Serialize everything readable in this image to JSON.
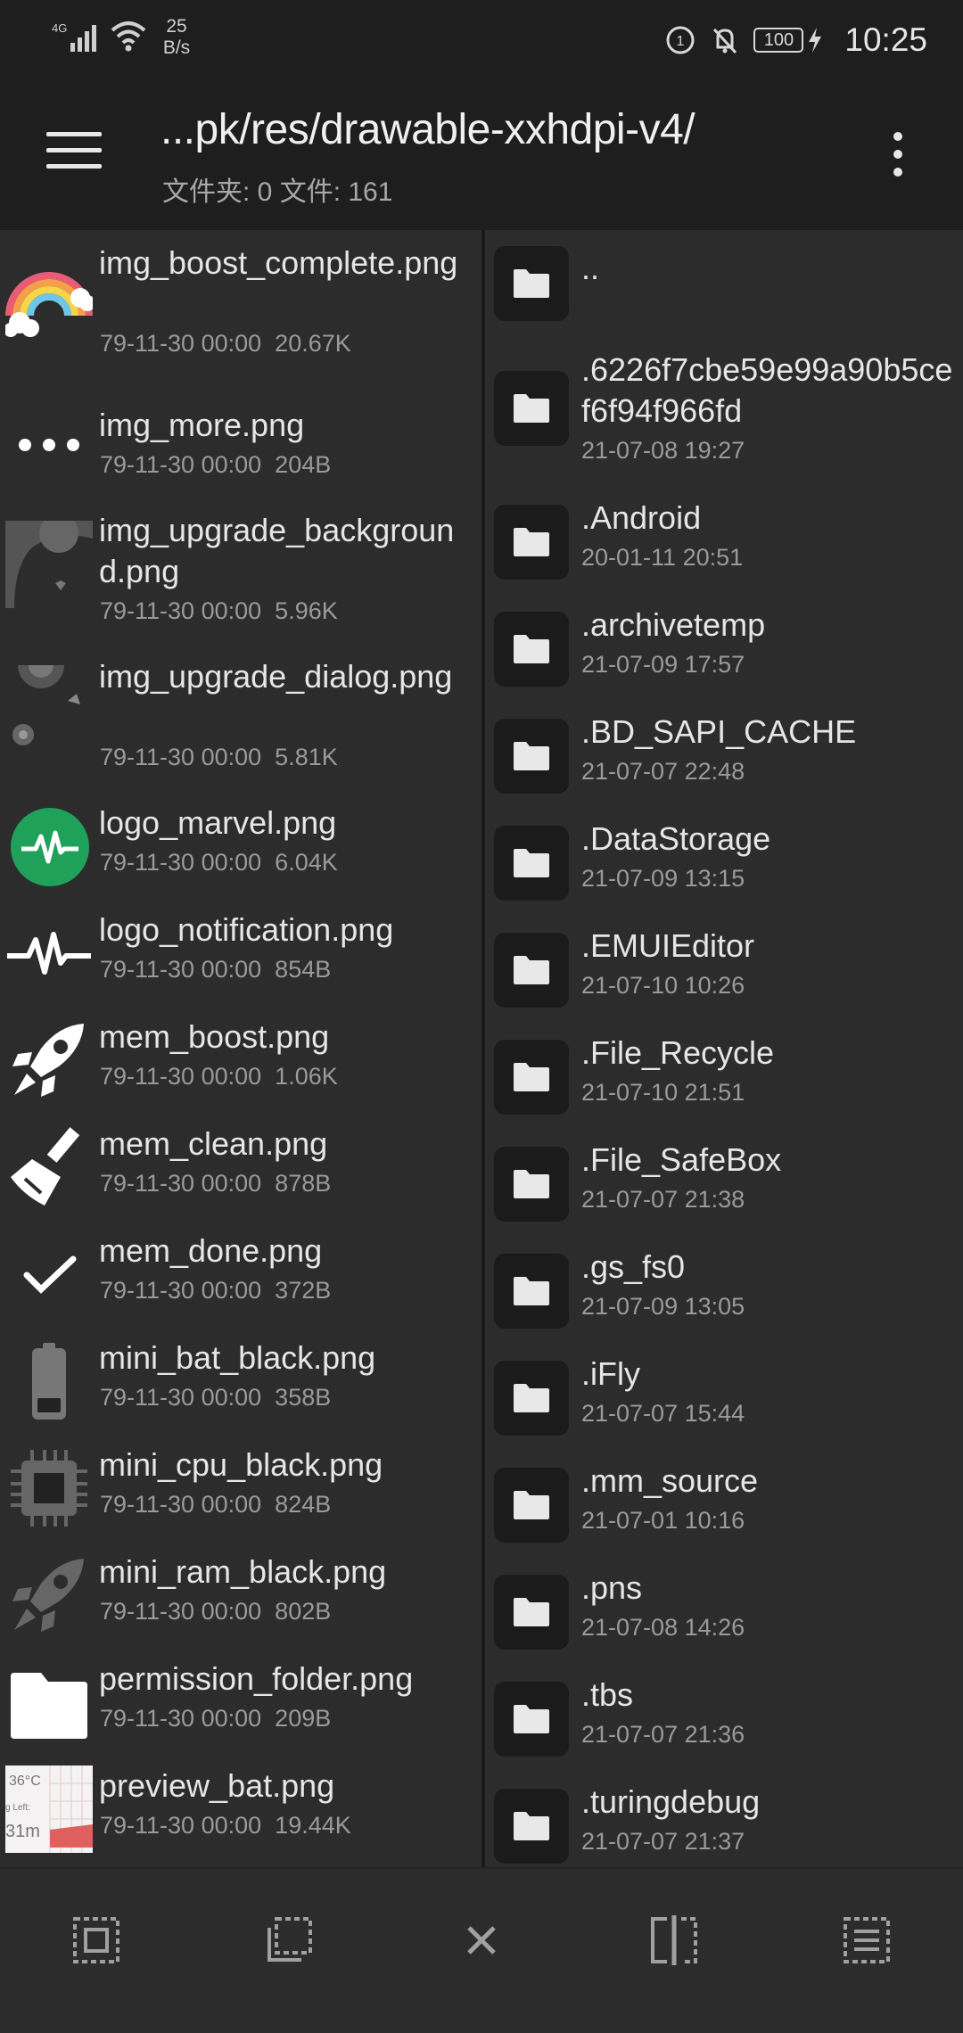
{
  "status_bar": {
    "network": "4G",
    "speed_value": "25",
    "speed_unit": "B/s",
    "battery": "100",
    "time": "10:25",
    "icons": [
      "signal-icon",
      "wifi-icon",
      "data-saver-icon",
      "mute-icon",
      "battery-icon",
      "charging-icon"
    ]
  },
  "toolbar": {
    "title": "...pk/res/drawable-xxhdpi-v4/",
    "subtitle": "文件夹: 0  文件: 161",
    "menu_icon": "hamburger-icon",
    "overflow_icon": "more-vert-icon"
  },
  "left_pane": {
    "files": [
      {
        "name": "img_boost_complete.png",
        "date": "79-11-30 00:00",
        "size": "20.67K",
        "thumb": "rainbow-thumb"
      },
      {
        "name": "img_more.png",
        "date": "79-11-30 00:00",
        "size": "204B",
        "thumb": "dots-thumb"
      },
      {
        "name": "img_upgrade_background.png",
        "date": "79-11-30 00:00",
        "size": "5.96K",
        "thumb": "upgrade-bg-thumb"
      },
      {
        "name": "img_upgrade_dialog.png",
        "date": "79-11-30 00:00",
        "size": "5.81K",
        "thumb": "upgrade-dialog-thumb"
      },
      {
        "name": "logo_marvel.png",
        "date": "79-11-30 00:00",
        "size": "6.04K",
        "thumb": "marvel-logo-thumb"
      },
      {
        "name": "logo_notification.png",
        "date": "79-11-30 00:00",
        "size": "854B",
        "thumb": "pulse-thumb"
      },
      {
        "name": "mem_boost.png",
        "date": "79-11-30 00:00",
        "size": "1.06K",
        "thumb": "rocket-thumb"
      },
      {
        "name": "mem_clean.png",
        "date": "79-11-30 00:00",
        "size": "878B",
        "thumb": "broom-thumb"
      },
      {
        "name": "mem_done.png",
        "date": "79-11-30 00:00",
        "size": "372B",
        "thumb": "check-thumb"
      },
      {
        "name": "mini_bat_black.png",
        "date": "79-11-30 00:00",
        "size": "358B",
        "thumb": "battery-thumb"
      },
      {
        "name": "mini_cpu_black.png",
        "date": "79-11-30 00:00",
        "size": "824B",
        "thumb": "cpu-thumb"
      },
      {
        "name": "mini_ram_black.png",
        "date": "79-11-30 00:00",
        "size": "802B",
        "thumb": "rocket-grey-thumb"
      },
      {
        "name": "permission_folder.png",
        "date": "79-11-30 00:00",
        "size": "209B",
        "thumb": "folder-white-thumb"
      },
      {
        "name": "preview_bat.png",
        "date": "79-11-30 00:00",
        "size": "19.44K",
        "thumb": "preview-bat-thumb"
      }
    ],
    "preview_bat_thumb_text": {
      "temp": "36°C",
      "left": "g Left:",
      "min": "31m"
    }
  },
  "right_pane": {
    "parent": "..",
    "folders": [
      {
        "name": ".6226f7cbe59e99a90b5cef6f94f966fd",
        "date": "21-07-08 19:27"
      },
      {
        "name": ".Android",
        "date": "20-01-11 20:51"
      },
      {
        "name": ".archivetemp",
        "date": "21-07-09 17:57"
      },
      {
        "name": ".BD_SAPI_CACHE",
        "date": "21-07-07 22:48"
      },
      {
        "name": ".DataStorage",
        "date": "21-07-09 13:15"
      },
      {
        "name": ".EMUIEditor",
        "date": "21-07-10 10:26"
      },
      {
        "name": ".File_Recycle",
        "date": "21-07-10 21:51"
      },
      {
        "name": ".File_SafeBox",
        "date": "21-07-07 21:38"
      },
      {
        "name": ".gs_fs0",
        "date": "21-07-09 13:05"
      },
      {
        "name": ".iFly",
        "date": "21-07-07 15:44"
      },
      {
        "name": ".mm_source",
        "date": "21-07-01 10:16"
      },
      {
        "name": ".pns",
        "date": "21-07-08 14:26"
      },
      {
        "name": ".tbs",
        "date": "21-07-07 21:36"
      },
      {
        "name": ".turingdebug",
        "date": "21-07-07 21:37"
      }
    ]
  },
  "bottom_bar": {
    "buttons": [
      "select-all-icon",
      "copy-select-icon",
      "close-icon",
      "split-view-icon",
      "list-select-icon"
    ]
  },
  "colors": {
    "background": "#1e1e1e",
    "pane": "#2c2c2c",
    "text": "#e6e6e6",
    "meta": "#9a9a9a",
    "marvel_green": "#1fa15a"
  }
}
